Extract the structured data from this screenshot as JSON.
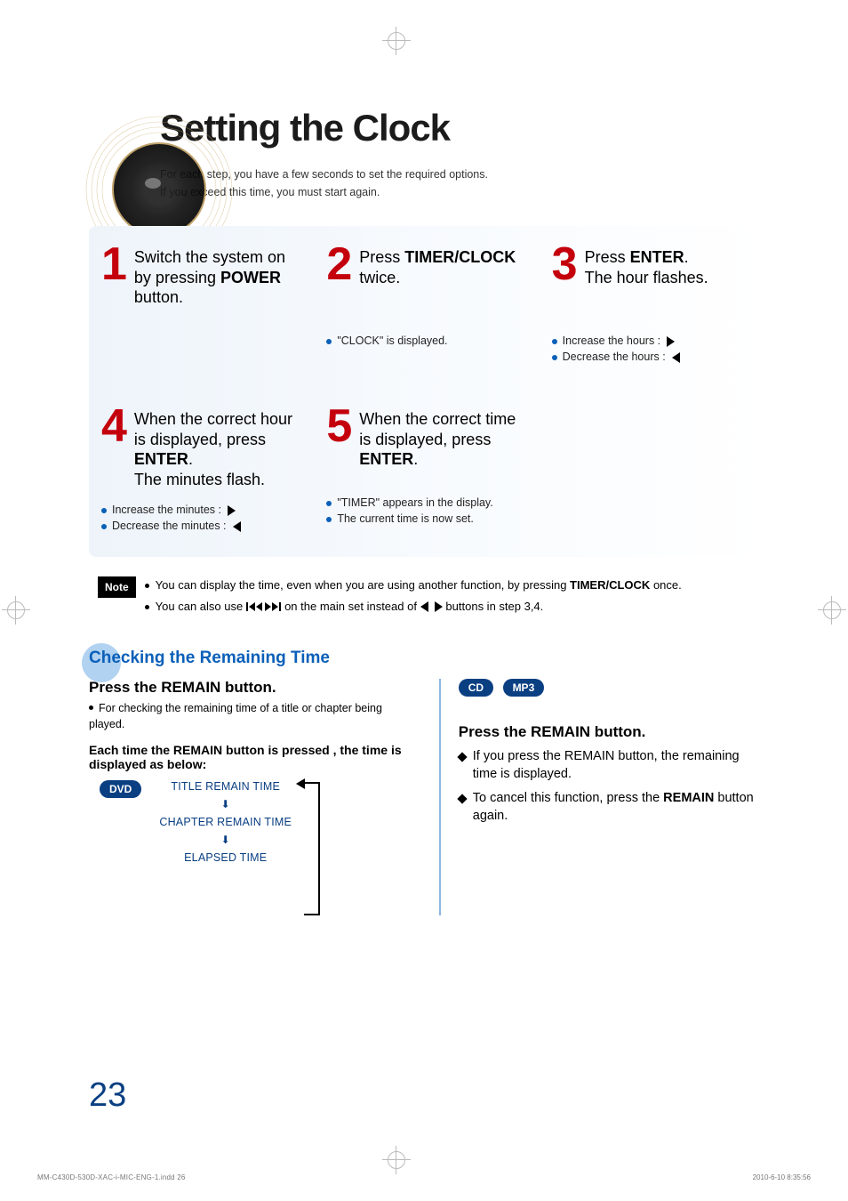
{
  "title": "Setting the Clock",
  "intro_l1": "For each step, you have a few seconds to set the required options.",
  "intro_l2": "If you exceed this time, you must start again.",
  "steps": {
    "s1": {
      "num": "1",
      "txt_a": "Switch the system on by pressing ",
      "txt_b": "POWER",
      "txt_c": " button."
    },
    "s2": {
      "num": "2",
      "txt_a": "Press ",
      "txt_b": "TIMER/CLOCK",
      "txt_c": " twice.",
      "sub1": "\"CLOCK\" is displayed."
    },
    "s3": {
      "num": "3",
      "txt_a": "Press ",
      "txt_b": "ENTER",
      "txt_c": ".",
      "txt_d": "The hour flashes.",
      "sub1": "Increase the hours :",
      "sub2": "Decrease the hours :"
    },
    "s4": {
      "num": "4",
      "txt_a": "When the correct hour is displayed, press ",
      "txt_b": "ENTER",
      "txt_c": ".",
      "txt_d": "The minutes flash.",
      "sub1": "Increase the minutes :",
      "sub2": "Decrease the minutes :"
    },
    "s5": {
      "num": "5",
      "txt_a": "When the correct time is displayed, press ",
      "txt_b": "ENTER",
      "txt_c": ".",
      "sub1": "\"TIMER\" appears in the display.",
      "sub2": "The current time is now set."
    }
  },
  "note": {
    "label": "Note",
    "l1a": "You can display the time, even when you are using another function, by pressing ",
    "l1b": "TIMER/CLOCK",
    "l1c": " once.",
    "l2a": "You can also use ",
    "l2b": " on the main set instead of ",
    "l2c": " buttons in step 3,4."
  },
  "sec2": {
    "title": "Checking the Remaining Time",
    "h_left": "Press the REMAIN button.",
    "left_sub": "For checking the remaining time of a title or chapter being played.",
    "left_bold": "Each time the REMAIN button is pressed , the time is displayed as below:",
    "dvd": "DVD",
    "flow1": "TITLE REMAIN TIME",
    "flow2": "CHAPTER REMAIN TIME",
    "flow3": "ELAPSED TIME",
    "cd": "CD",
    "mp3": "MP3",
    "h_right": "Press the REMAIN button.",
    "r1": "If you press the REMAIN button, the remaining time is displayed.",
    "r2a": "To cancel this function, press the ",
    "r2b": "REMAIN",
    "r2c": " button again."
  },
  "page_num": "23",
  "footer_l": "MM-C430D-530D-XAC-i-MIC-ENG-1.indd   26",
  "footer_r": "2010-6-10   8:35:56"
}
